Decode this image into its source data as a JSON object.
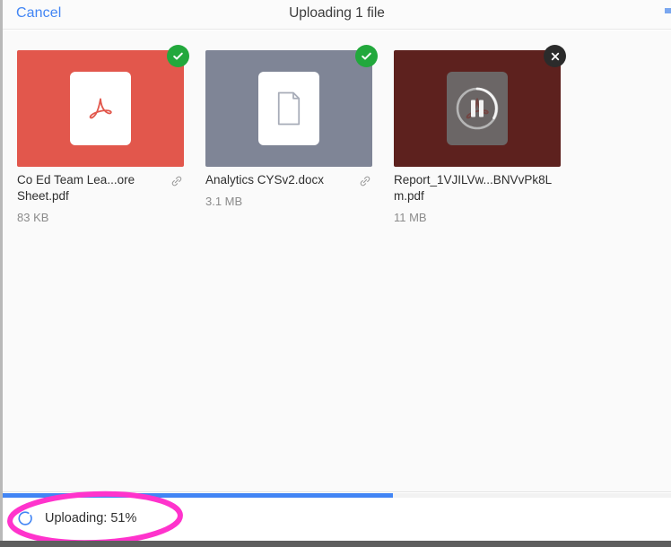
{
  "header": {
    "cancel_label": "Cancel",
    "title": "Uploading 1 file",
    "action_label": "",
    "cancel_color": "#4285f4"
  },
  "files": [
    {
      "name": "Co Ed Team Lea...ore Sheet.pdf",
      "size": "83 KB",
      "type": "pdf",
      "thumb_class": "red",
      "thumb_color": "#e2574c",
      "status": "done",
      "badge_icon": "check-icon",
      "link_icon": "link-icon"
    },
    {
      "name": "Analytics CYSv2.docx",
      "size": "3.1 MB",
      "type": "docx",
      "thumb_class": "slate",
      "thumb_color": "#7f8596",
      "status": "done",
      "badge_icon": "check-icon",
      "link_icon": "link-icon"
    },
    {
      "name": "Report_1VJILVw...BNVvPk8Lm.pdf",
      "size": "11 MB",
      "type": "pdf",
      "thumb_class": "dark",
      "thumb_color": "#5d211e",
      "status": "uploading",
      "badge_icon": "close-icon",
      "overlay_icon": "pause-icon",
      "link_icon": null
    }
  ],
  "footer": {
    "status_text": "Uploading: 51%",
    "progress_percent": 51,
    "progress_bar_width_percent": 58.4,
    "progress_color": "#4285f4",
    "spinner_icon": "spinner-icon"
  },
  "annotation": {
    "shape": "ellipse",
    "color": "#ff33cc"
  }
}
